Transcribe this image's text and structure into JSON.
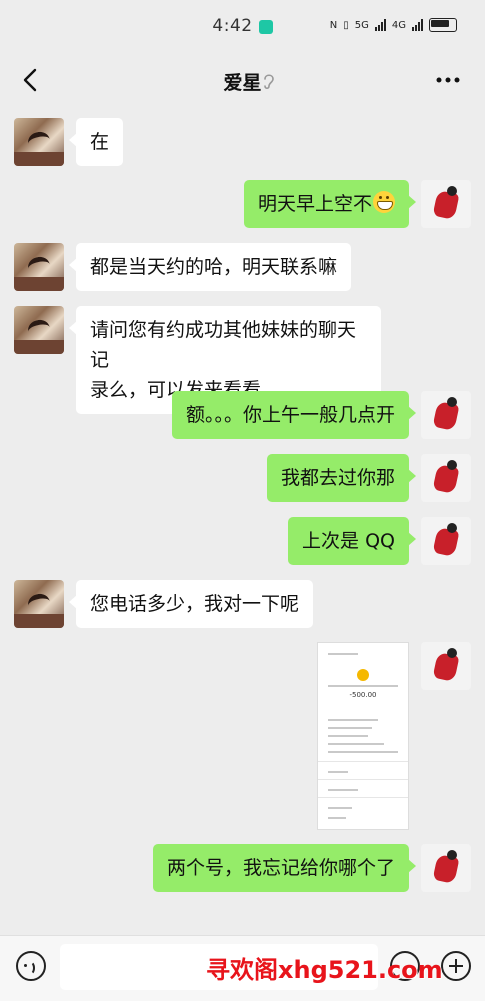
{
  "status_bar": {
    "time": "4:42",
    "network_1": "5G",
    "network_2": "4G"
  },
  "header": {
    "title": "爱星"
  },
  "messages": [
    {
      "side": "in",
      "text": "在"
    },
    {
      "side": "out",
      "text": "明天早上空不",
      "emoji": "grin-icon"
    },
    {
      "side": "in",
      "text": "都是当天约的哈，明天联系嘛"
    },
    {
      "side": "in",
      "text_line1": "请问您有约成功其他妹妹的聊天记",
      "text_line2": "录么，可以发来看看"
    },
    {
      "side": "out",
      "text": "额。。。你上午一般几点开"
    },
    {
      "side": "out",
      "text": "我都去过你那"
    },
    {
      "side": "out",
      "text": "上次是 QQ"
    },
    {
      "side": "in",
      "text": "您电话多少，我对一下呢"
    },
    {
      "side": "out",
      "type": "image",
      "amount": "-500.00"
    },
    {
      "side": "out",
      "text": "两个号，我忘记给你哪个了"
    }
  ],
  "input": {
    "value": ""
  },
  "watermark": "寻欢阁xhg521.com",
  "colors": {
    "background": "#ededed",
    "outgoing_bubble": "#95ec69",
    "incoming_bubble": "#ffffff",
    "watermark": "#e8141b"
  }
}
